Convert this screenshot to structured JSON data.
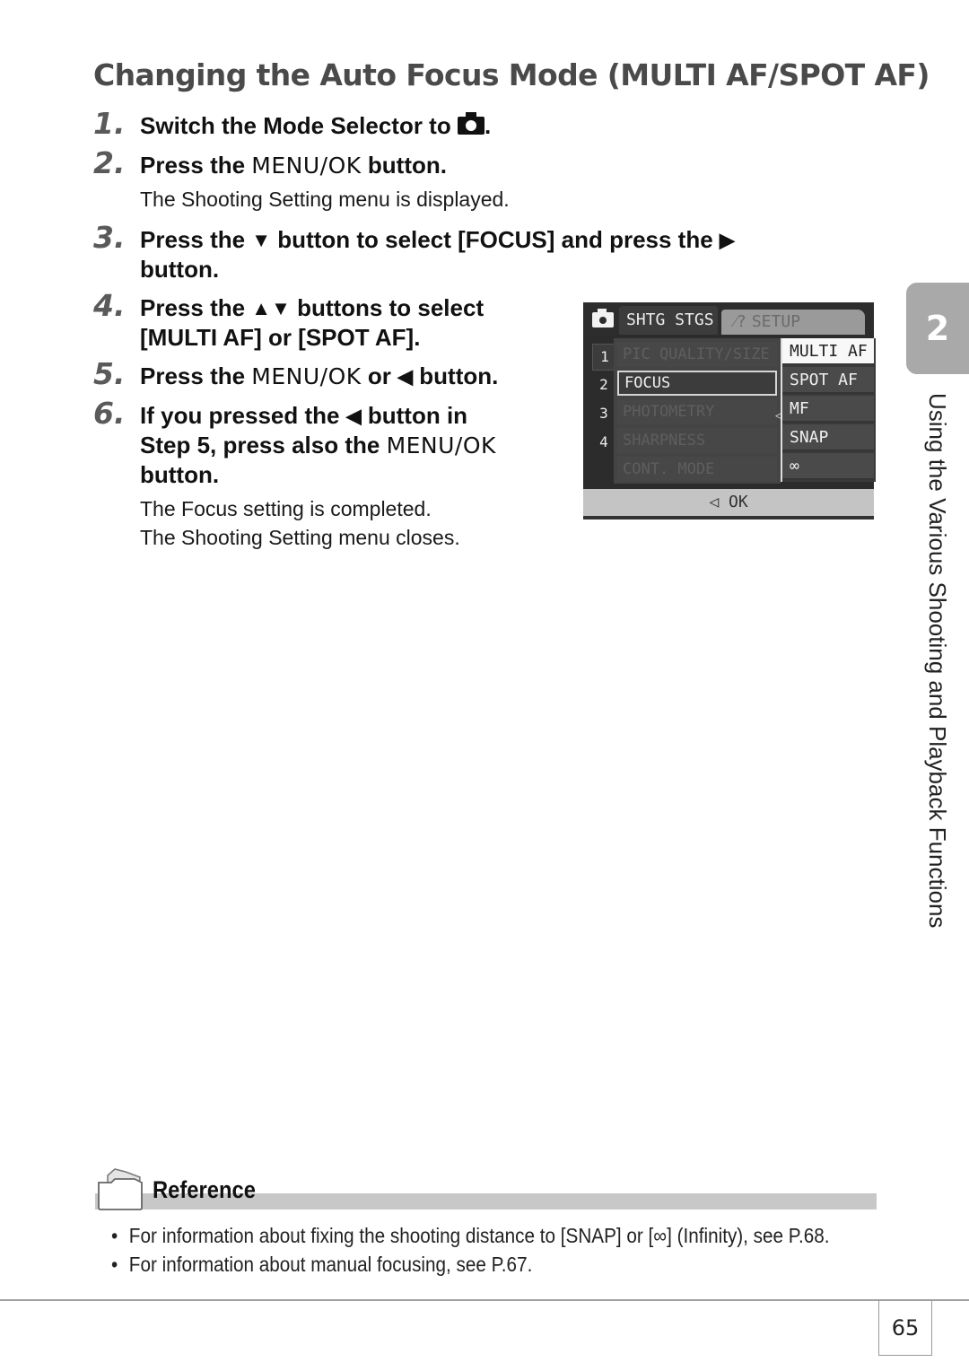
{
  "page": {
    "title": "Changing the Auto Focus Mode (MULTI AF/SPOT AF)",
    "steps": [
      {
        "num": "1.",
        "lines": [
          "Switch the Mode Selector to ",
          "."
        ],
        "icon": "camera-icon"
      },
      {
        "num": "2.",
        "pre": "Press the ",
        "key": "MENU/OK",
        "post": " button.",
        "note": "The Shooting Setting menu is displayed."
      },
      {
        "num": "3.",
        "line1_pre": "Press the ",
        "line1_mid": " button to select [FOCUS] and press the ",
        "line2": "button."
      },
      {
        "num": "4.",
        "line1_pre": "Press the ",
        "line1_post": " buttons to select",
        "line2": "[MULTI AF] or [SPOT AF]."
      },
      {
        "num": "5.",
        "pre": "Press the ",
        "key": "MENU/OK",
        "mid": " or ",
        "post": " button."
      },
      {
        "num": "6.",
        "line1_pre": "If you pressed the ",
        "line1_post": " button in",
        "line2_pre": "Step 5, press also the ",
        "line2_key": "MENU/OK",
        "line3": "button.",
        "notes": [
          "The Focus setting is completed.",
          "The Shooting Setting menu closes."
        ]
      }
    ],
    "glyphs": {
      "down": "▼",
      "right": "▶",
      "updown": "▲▼",
      "left": "◀"
    }
  },
  "camera_screen": {
    "tabs": [
      {
        "label": "SHTG STGS",
        "active": true
      },
      {
        "label": "SETUP",
        "active": false,
        "icon": "wrench-icon"
      }
    ],
    "setup_icon_text": "⁄?",
    "page_numbers": [
      "1",
      "2",
      "3",
      "4"
    ],
    "menu_items": [
      "PIC QUALITY/SIZE",
      "FOCUS",
      "PHOTOMETRY",
      "SHARPNESS",
      "CONT. MODE"
    ],
    "selected_item": "FOCUS",
    "options": [
      "MULTI AF",
      "SPOT AF",
      "MF",
      "SNAP",
      "∞"
    ],
    "highlighted_option": "MULTI AF",
    "footer": "◁ OK"
  },
  "side": {
    "chapter_number": "2",
    "chapter_title": "Using the Various Shooting and Playback Functions"
  },
  "reference": {
    "label": "Reference",
    "items": [
      "For information about fixing the shooting distance to [SNAP] or [∞] (Infinity), see P.68.",
      "For information about manual focusing, see P.67."
    ],
    "bullet": "•"
  },
  "footer": {
    "page_number": "65"
  }
}
